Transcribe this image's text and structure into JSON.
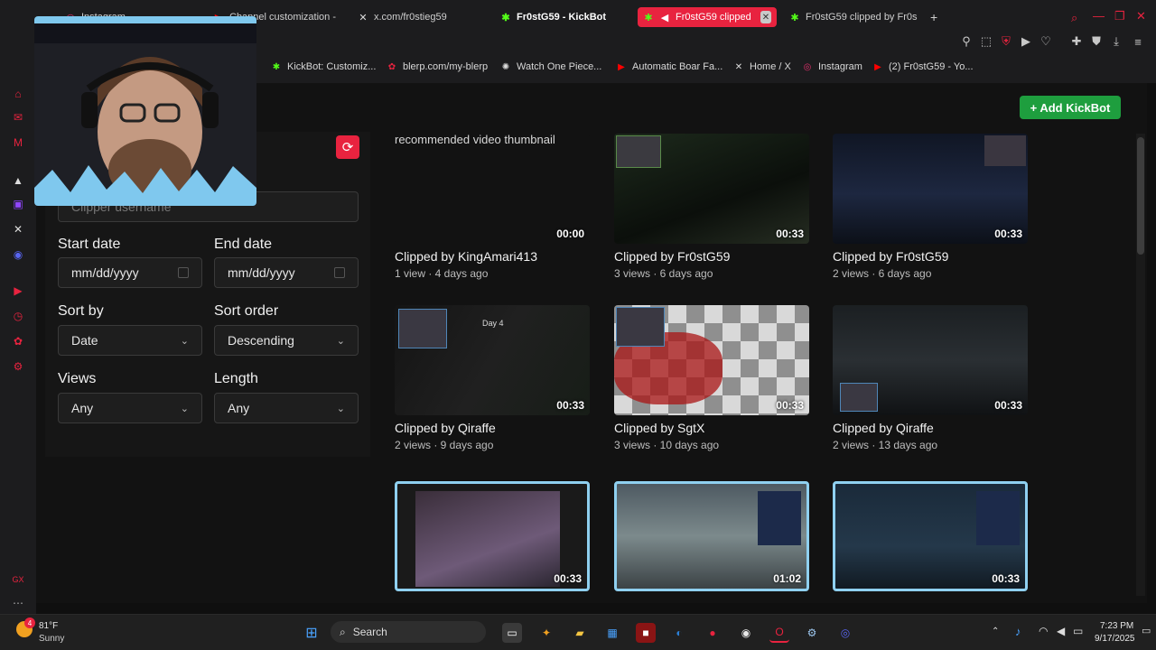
{
  "tabs": [
    {
      "label": "Instagram",
      "icon": "instagram-icon",
      "state": "normal"
    },
    {
      "label": "Channel customization -",
      "icon": "youtube-icon",
      "state": "normal"
    },
    {
      "label": "x.com/fr0stieg59",
      "icon": "x-icon",
      "state": "normal"
    },
    {
      "label": "Fr0stG59 - KickBot",
      "icon": "kickbot-icon",
      "state": "selected"
    },
    {
      "label": "Fr0stG59 clipped",
      "icon": "kickbot-icon",
      "state": "active"
    },
    {
      "label": "Fr0stG59 clipped by Fr0s",
      "icon": "kickbot-icon",
      "state": "normal"
    }
  ],
  "new_tab_label": "+",
  "bookmarks": [
    {
      "label": "KickBot: Customiz...",
      "icon": "kickbot-icon"
    },
    {
      "label": "blerp.com/my-blerp",
      "icon": "blerp-icon"
    },
    {
      "label": "Watch One Piece...",
      "icon": "onepiece-icon"
    },
    {
      "label": "Automatic Boar Fa...",
      "icon": "youtube-icon"
    },
    {
      "label": "Home / X",
      "icon": "x-icon"
    },
    {
      "label": "Instagram",
      "icon": "instagram-icon"
    },
    {
      "label": "(2) Fr0stG59 - Yo...",
      "icon": "youtube-icon"
    }
  ],
  "add_button_label": "+ Add KickBot",
  "filters": {
    "clipper_placeholder": "Clipper username",
    "start_date_label": "Start date",
    "start_date_value": "mm/dd/yyyy",
    "end_date_label": "End date",
    "end_date_value": "mm/dd/yyyy",
    "sort_by_label": "Sort by",
    "sort_by_value": "Date",
    "sort_order_label": "Sort order",
    "sort_order_value": "Descending",
    "views_label": "Views",
    "views_value": "Any",
    "length_label": "Length",
    "length_value": "Any"
  },
  "clips": [
    {
      "thumb_alt": "recommended video thumbnail",
      "duration": "00:00",
      "title": "Clipped by KingAmari413",
      "meta": "1 view · 4 days ago",
      "style": "broken"
    },
    {
      "thumb_alt": "",
      "duration": "00:33",
      "title": "Clipped by Fr0stG59",
      "meta": "3 views · 6 days ago",
      "style": "dark-green"
    },
    {
      "thumb_alt": "",
      "duration": "00:33",
      "title": "Clipped by Fr0stG59",
      "meta": "2 views · 6 days ago",
      "style": "dark-blue"
    },
    {
      "thumb_alt": "Day 4",
      "duration": "00:33",
      "title": "Clipped by Qiraffe",
      "meta": "2 views · 9 days ago",
      "style": "dark-room"
    },
    {
      "thumb_alt": "",
      "duration": "00:33",
      "title": "Clipped by SgtX",
      "meta": "3 views · 10 days ago",
      "style": "checker-red"
    },
    {
      "thumb_alt": "",
      "duration": "00:33",
      "title": "Clipped by Qiraffe",
      "meta": "2 views · 13 days ago",
      "style": "dark-grey"
    },
    {
      "thumb_alt": "",
      "duration": "00:33",
      "title": "",
      "meta": "",
      "style": "frame-cam"
    },
    {
      "thumb_alt": "",
      "duration": "01:02",
      "title": "",
      "meta": "",
      "style": "frame-street"
    },
    {
      "thumb_alt": "",
      "duration": "00:33",
      "title": "",
      "meta": "",
      "style": "frame-space"
    }
  ],
  "taskbar": {
    "weather_temp": "81°F",
    "weather_desc": "Sunny",
    "weather_badge": "4",
    "search_placeholder": "Search",
    "time": "7:23 PM",
    "date": "9/17/2025"
  },
  "colors": {
    "accent_red": "#e8233f",
    "kick_green": "#1e9e3e"
  }
}
